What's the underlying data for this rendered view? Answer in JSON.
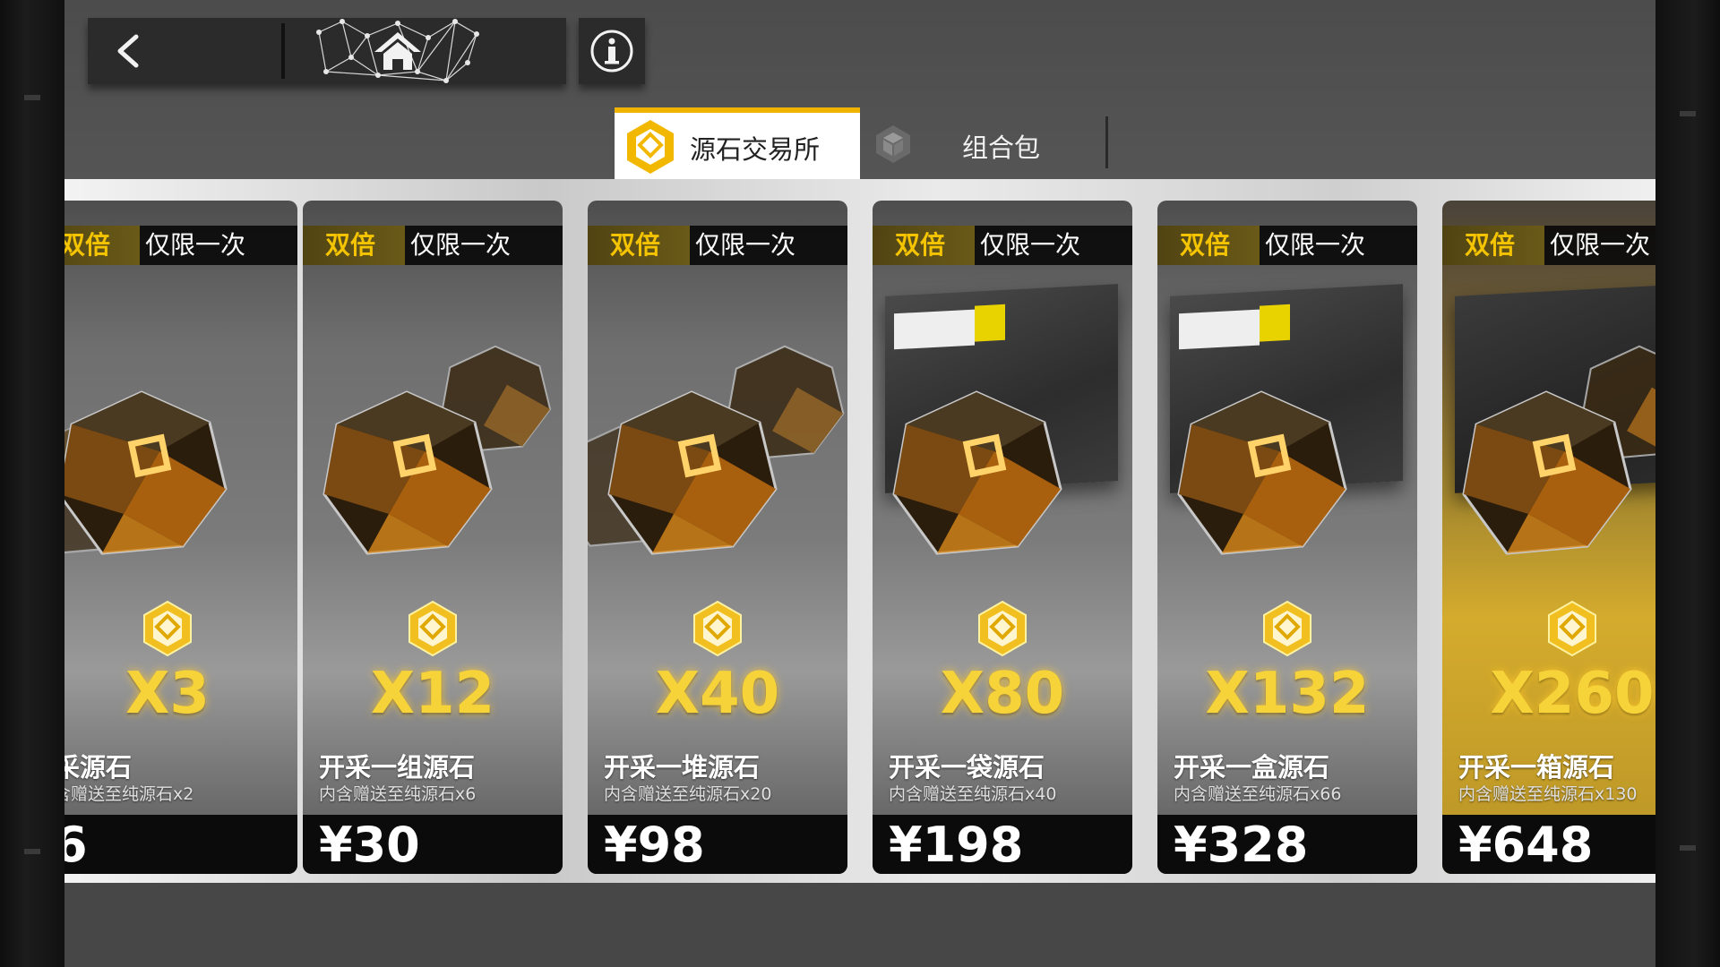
{
  "nav": {
    "back_icon": "chevron-left-icon",
    "home_icon": "home-icon",
    "info_icon": "info-icon"
  },
  "tabs": [
    {
      "label": "源石交易所",
      "icon": "originite-icon",
      "active": true
    },
    {
      "label": "组合包",
      "icon": "bundle-icon",
      "active": false
    }
  ],
  "colors": {
    "accent": "#f0b400",
    "amount": "#f7d33a"
  },
  "cards": [
    {
      "badge": "双倍",
      "limit": "仅限一次",
      "amount": "X3",
      "name": "采源石",
      "bonus": "含赠送至纯源石x2",
      "price": "6"
    },
    {
      "badge": "双倍",
      "limit": "仅限一次",
      "amount": "X12",
      "name": "开采一组源石",
      "bonus": "内含赠送至纯源石x6",
      "price": "¥30"
    },
    {
      "badge": "双倍",
      "limit": "仅限一次",
      "amount": "X40",
      "name": "开采一堆源石",
      "bonus": "内含赠送至纯源石x20",
      "price": "¥98"
    },
    {
      "badge": "双倍",
      "limit": "仅限一次",
      "amount": "X80",
      "name": "开采一袋源石",
      "bonus": "内含赠送至纯源石x40",
      "price": "¥198"
    },
    {
      "badge": "双倍",
      "limit": "仅限一次",
      "amount": "X132",
      "name": "开采一盒源石",
      "bonus": "内含赠送至纯源石x66",
      "price": "¥328"
    },
    {
      "badge": "双倍",
      "limit": "仅限一次",
      "amount": "X260",
      "name": "开采一箱源石",
      "bonus": "内含赠送至纯源石x130",
      "price": "¥648"
    }
  ]
}
